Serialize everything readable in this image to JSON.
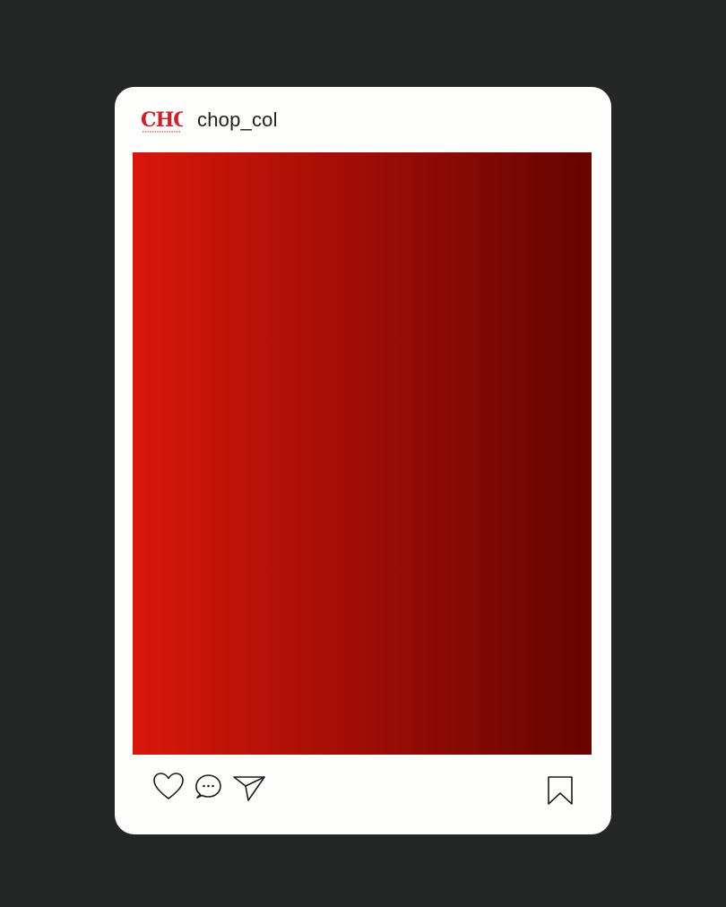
{
  "post": {
    "username": "chop_col",
    "logo_text": "CHOP",
    "image_gradient": {
      "left_color": "#d8170a",
      "right_color": "#650402"
    },
    "card_color": "#fdfdfc",
    "background_color": "#242525"
  },
  "actions": {
    "like_icon": "heart-icon",
    "comment_icon": "speech-bubble-icon",
    "share_icon": "paper-plane-icon",
    "save_icon": "bookmark-icon"
  }
}
